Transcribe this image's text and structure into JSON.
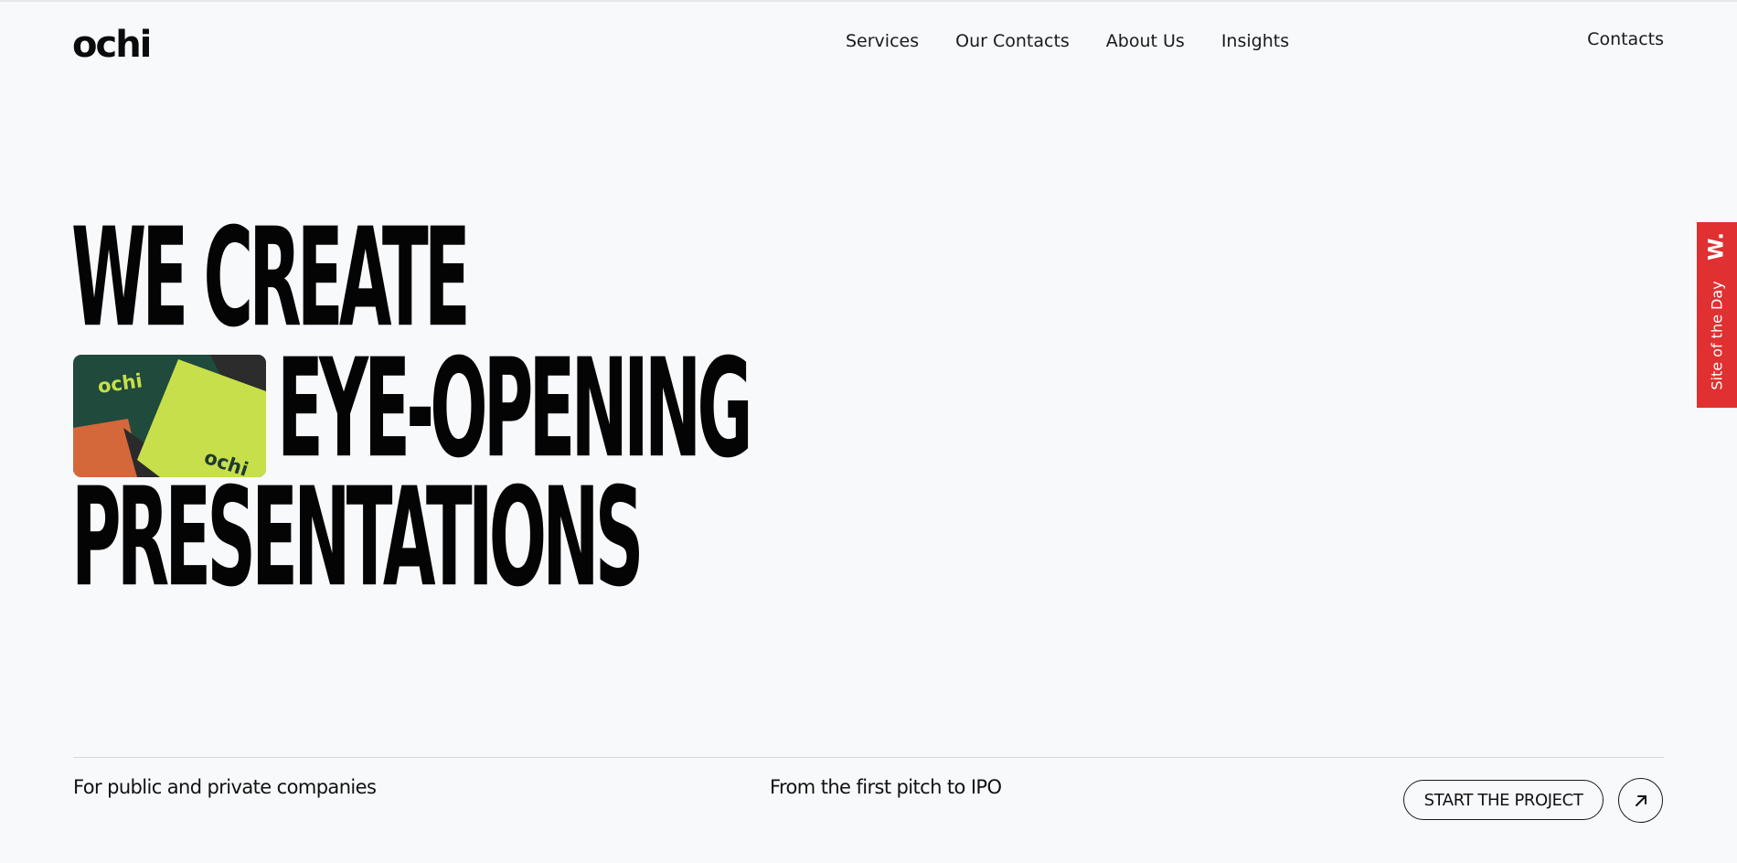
{
  "header": {
    "logo_text": "ochi",
    "nav": [
      {
        "label": "Services"
      },
      {
        "label": "Our Contacts"
      },
      {
        "label": "About Us"
      },
      {
        "label": "Insights"
      }
    ],
    "contacts_label": "Contacts"
  },
  "hero": {
    "line1": "WE CREATE",
    "line2": "EYE-OPENING",
    "line3": "PRESENTATIONS",
    "image": {
      "logo_text_1": "ochi",
      "logo_text_2": "ochi",
      "colors": {
        "dark_green": "#1f4a3c",
        "lime": "#c7df4a",
        "orange": "#d5683a",
        "charcoal": "#2c2c2c"
      }
    }
  },
  "badge": {
    "w_mark": "W.",
    "text": "Site of the Day",
    "color": "#e03031"
  },
  "bottom": {
    "left_text": "For public and private companies",
    "middle_text": "From the first pitch to IPO",
    "cta_label": "START THE PROJECT",
    "cta_icon": "arrow-up-right-icon"
  }
}
